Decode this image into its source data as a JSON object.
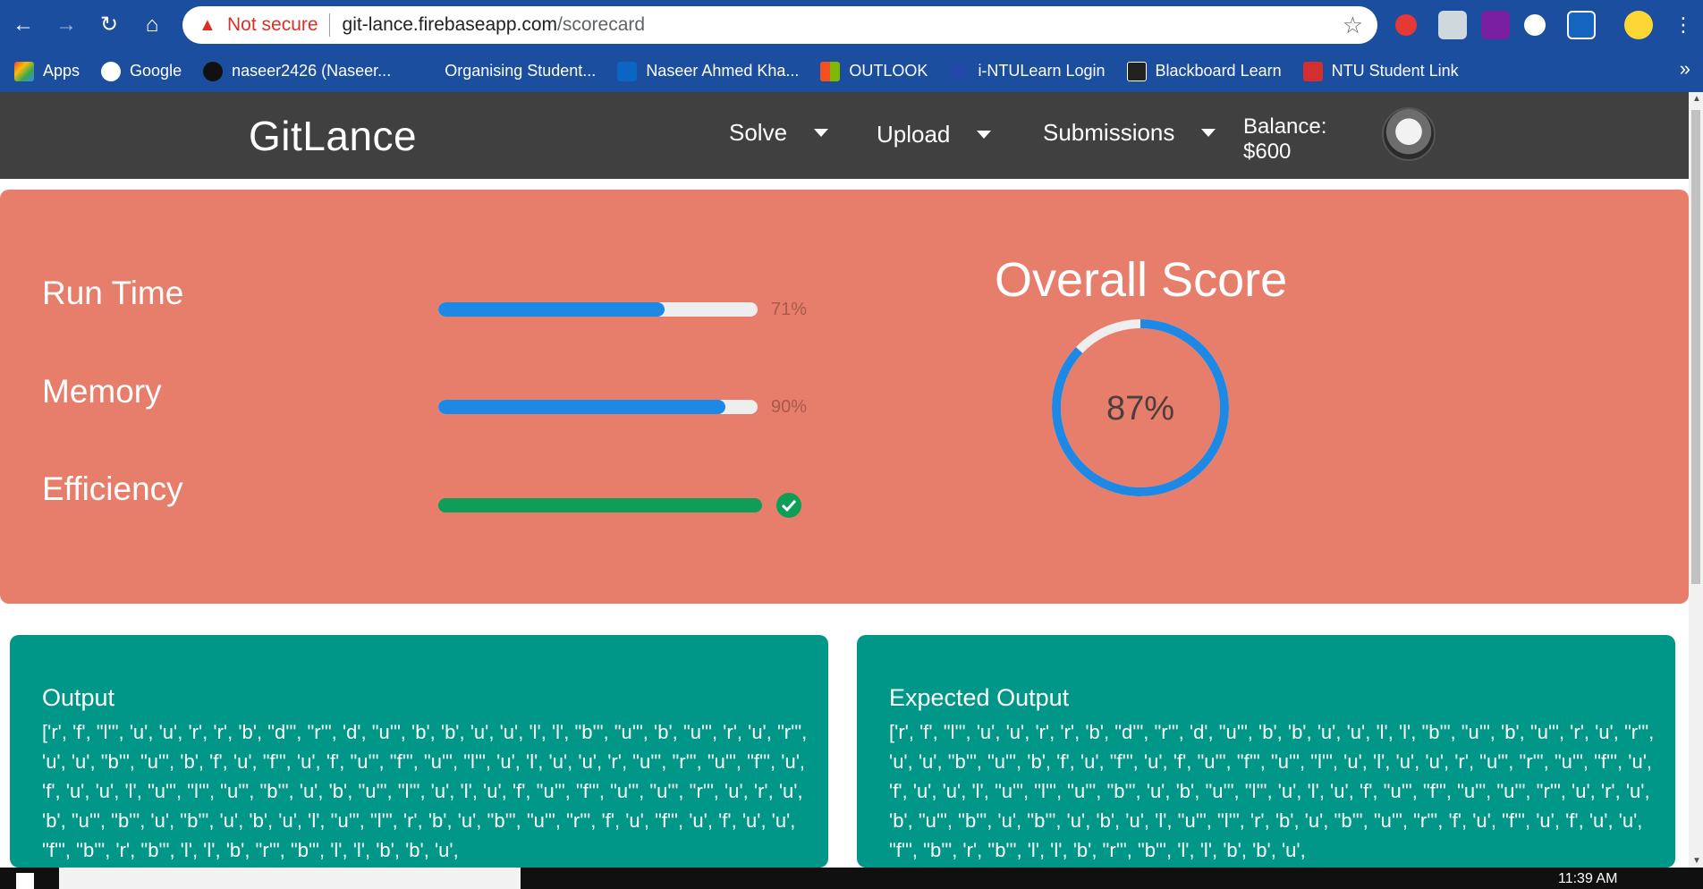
{
  "browser": {
    "security_label": "Not secure",
    "url_host": "git-lance.firebaseapp.com",
    "url_path": "/scorecard",
    "bookmarks": [
      {
        "label": "Apps",
        "icon": "apps-grid-icon"
      },
      {
        "label": "Google",
        "icon": "google-icon"
      },
      {
        "label": "naseer2426 (Naseer...",
        "icon": "github-icon"
      },
      {
        "label": "Organising Student...",
        "icon": "blank-icon"
      },
      {
        "label": "Naseer Ahmed Kha...",
        "icon": "linkedin-icon"
      },
      {
        "label": "OUTLOOK",
        "icon": "microsoft-icon"
      },
      {
        "label": "i-NTULearn Login",
        "icon": "ntulearn-icon"
      },
      {
        "label": "Blackboard Learn",
        "icon": "blackboard-icon"
      },
      {
        "label": "NTU Student Link",
        "icon": "ntu-icon"
      }
    ]
  },
  "navbar": {
    "brand": "GitLance",
    "items": [
      "Solve",
      "Upload",
      "Submissions"
    ],
    "balance_label": "Balance:",
    "balance_value": "$600"
  },
  "scorecard": {
    "metrics": [
      {
        "label": "Run Time",
        "percent_text": "71%",
        "progress": 0.71
      },
      {
        "label": "Memory",
        "percent_text": "90%",
        "progress": 0.9
      },
      {
        "label": "Efficiency",
        "percent_text": "",
        "progress": 1.0,
        "status": "passed"
      }
    ],
    "overall_title": "Overall Score",
    "overall_text": "87%",
    "overall_progress": 0.87,
    "colors": {
      "card": "#e77e6c",
      "bar": "#1e88e5",
      "pass": "#0f9d58",
      "track": "#eeeeee"
    }
  },
  "output": {
    "title": "Output",
    "text": "['r', 'f', \"l'\", 'u', 'u', 'r', 'r', 'b', \"d'\", \"r'\", 'd', \"u'\", 'b', 'b', 'u', 'u', 'l', 'l', \"b'\", \"u'\", 'b', \"u'\", 'r', 'u', \"r'\", 'u', 'u', \"b'\", \"u'\", 'b', 'f', 'u', \"f'\", 'u', 'f', \"u'\", \"f'\", \"u'\", \"l'\", 'u', 'l', 'u', 'u', 'r', \"u'\", \"r'\", \"u'\", \"f'\", 'u', 'f', 'u', 'u', 'l', \"u'\", \"l'\", \"u'\", \"b'\", 'u', 'b', \"u'\", \"l'\", 'u', 'l', 'u', 'f', \"u'\", \"f'\", \"u'\", \"u'\", \"r'\", 'u', 'r', 'u', 'b', \"u'\", \"b'\", 'u', \"b'\", 'u', 'b', 'u', 'l', \"u'\", \"l'\", 'r', 'b', 'u', \"b'\", \"u'\", \"r'\", 'f', 'u', \"f'\", 'u', 'f', 'u', 'u', \"f'\", \"b'\", 'r', \"b'\", 'l', 'l', 'b', \"r'\", \"b'\", 'l', 'l', 'b', 'b', 'u',"
  },
  "expected_output": {
    "title": "Expected Output",
    "text": "['r', 'f', \"l'\", 'u', 'u', 'r', 'r', 'b', \"d'\", \"r'\", 'd', \"u'\", 'b', 'b', 'u', 'u', 'l', 'l', \"b'\", \"u'\", 'b', \"u'\", 'r', 'u', \"r'\", 'u', 'u', \"b'\", \"u'\", 'b', 'f', 'u', \"f'\", 'u', 'f', \"u'\", \"f'\", \"u'\", \"l'\", 'u', 'l', 'u', 'u', 'r', \"u'\", \"r'\", \"u'\", \"f'\", 'u', 'f', 'u', 'u', 'l', \"u'\", \"l'\", \"u'\", \"b'\", 'u', 'b', \"u'\", \"l'\", 'u', 'l', 'u', 'f', \"u'\", \"f'\", \"u'\", \"u'\", \"r'\", 'u', 'r', 'u', 'b', \"u'\", \"b'\", 'u', \"b'\", 'u', 'b', 'u', 'l', \"u'\", \"l'\", 'r', 'b', 'u', \"b'\", \"u'\", \"r'\", 'f', 'u', \"f'\", 'u', 'f', 'u', 'u', \"f'\", \"b'\", 'r', \"b'\", 'l', 'l', 'b', \"r'\", \"b'\", 'l', 'l', 'b', 'b', 'u',"
  },
  "taskbar": {
    "time": "11:39 AM"
  }
}
